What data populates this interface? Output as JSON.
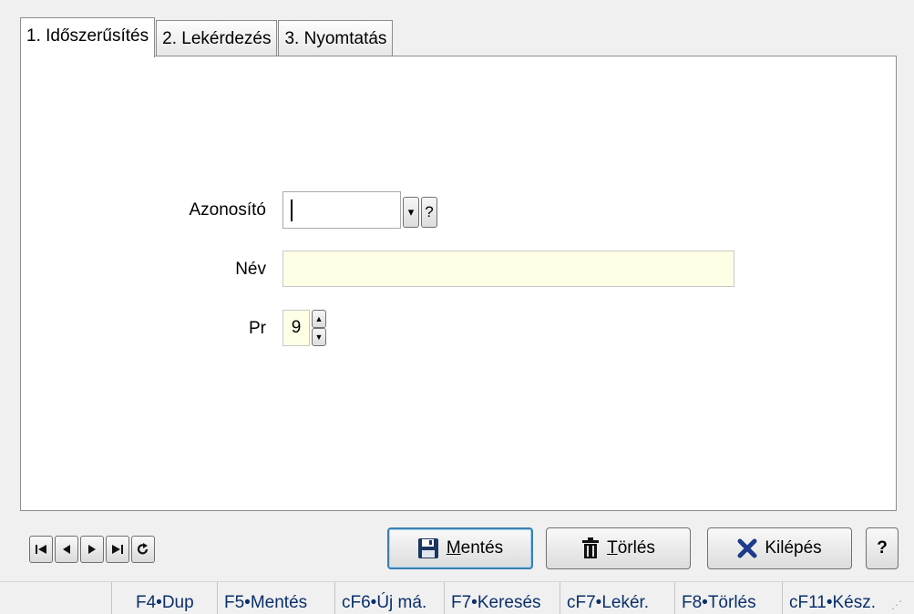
{
  "tabs": [
    {
      "label": "1. Időszerűsítés",
      "active": true
    },
    {
      "label": "2. Lekérdezés",
      "active": false
    },
    {
      "label": "3. Nyomtatás",
      "active": false
    }
  ],
  "form": {
    "azonosito_label": "Azonosító",
    "azonosito_value": "",
    "dropdown_glyph": "▾",
    "help_glyph": "?",
    "nev_label": "Név",
    "nev_value": "",
    "pr_label": "Pr",
    "pr_value": "9"
  },
  "navigation": {
    "first_icon": "first-record-icon",
    "prev_icon": "previous-record-icon",
    "next_icon": "next-record-icon",
    "last_icon": "last-record-icon",
    "refresh_icon": "refresh-icon"
  },
  "buttons": {
    "save_label": "Mentés",
    "delete_label": "Törlés",
    "exit_label": "Kilépés",
    "help_label": "?"
  },
  "statusbar": {
    "items": [
      "F4•Dup",
      "F5•Mentés",
      "cF6•Új má.",
      "F7•Keresés",
      "cF7•Lekér.",
      "F8•Törlés",
      "cF11•Kész."
    ]
  },
  "colors": {
    "accent_border": "#3c7fb1",
    "field_yellow": "#ffffe6",
    "exit_x": "#1e3a8a",
    "statusbar_text": "#0a2f6b"
  }
}
